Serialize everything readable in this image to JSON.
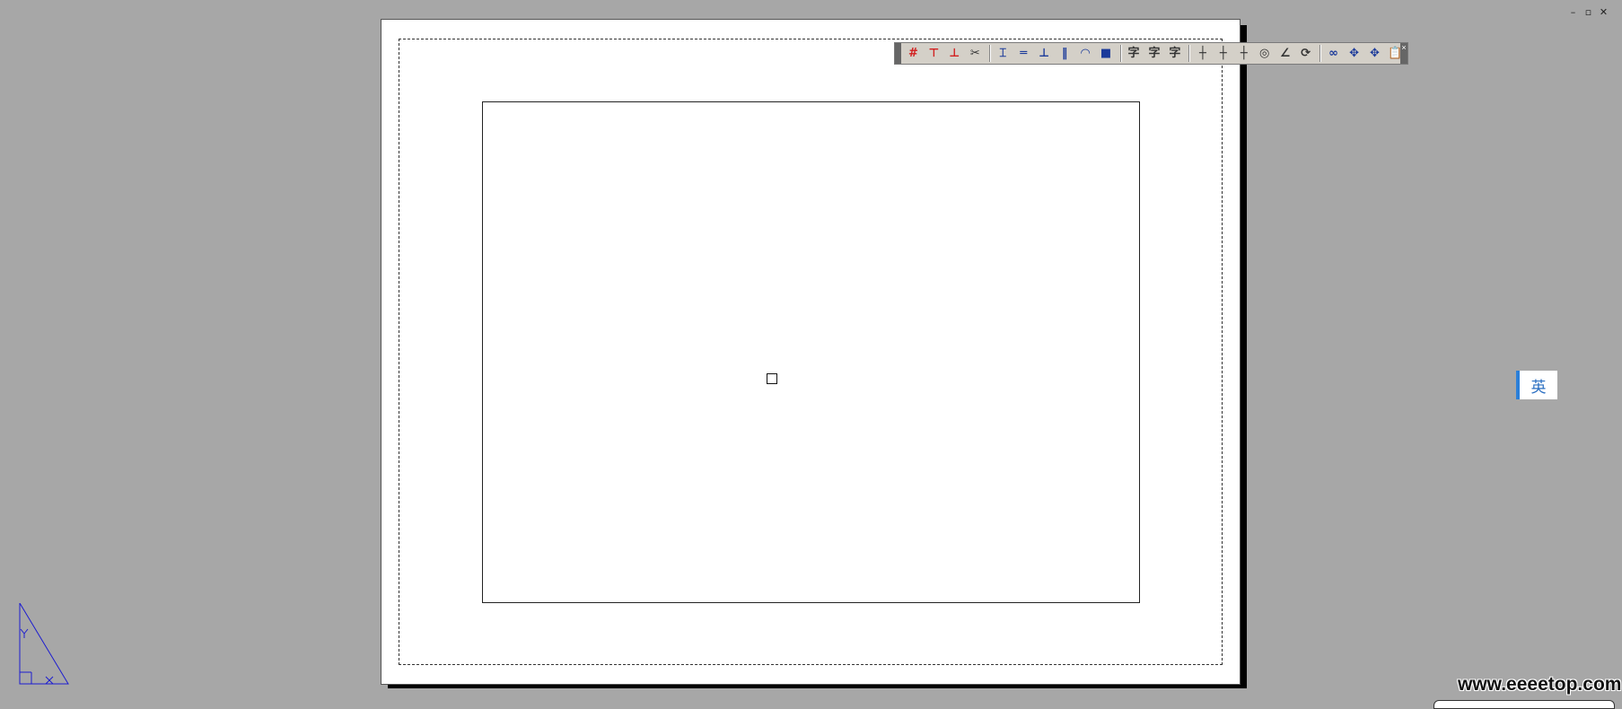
{
  "window_controls": {
    "minimize": "–",
    "restore": "▫",
    "close": "✕"
  },
  "toolbar": {
    "close": "×",
    "icons": [
      {
        "name": "dim-grid-red-icon",
        "glyph": "#",
        "color": "red"
      },
      {
        "name": "dim-pair-red-icon",
        "glyph": "⊤",
        "color": "red"
      },
      {
        "name": "dim-tee-red-icon",
        "glyph": "⊥",
        "color": "red"
      },
      {
        "name": "scissors-icon",
        "glyph": "✂",
        "color": "dark"
      },
      {
        "sep": true
      },
      {
        "name": "center-mark-icon",
        "glyph": "⌶",
        "color": "blue"
      },
      {
        "name": "double-line-icon",
        "glyph": "═",
        "color": "blue"
      },
      {
        "name": "baseline-dim-icon",
        "glyph": "⊥",
        "color": "blue"
      },
      {
        "name": "vertical-dim-icon",
        "glyph": "‖",
        "color": "blue"
      },
      {
        "name": "arc-dim-icon",
        "glyph": "◠",
        "color": "blue"
      },
      {
        "name": "block-icon",
        "glyph": "■",
        "color": "blue"
      },
      {
        "sep": true
      },
      {
        "name": "text-style-icon",
        "glyph": "字",
        "color": "dark"
      },
      {
        "name": "text-icon",
        "glyph": "字",
        "color": "dark"
      },
      {
        "name": "text-edit-icon",
        "glyph": "字",
        "color": "dark"
      },
      {
        "sep": true
      },
      {
        "name": "hatch-grid-icon",
        "glyph": "┼",
        "color": "dark"
      },
      {
        "name": "linear-dim-icon",
        "glyph": "┼",
        "color": "dark"
      },
      {
        "name": "continue-dim-icon",
        "glyph": "┼",
        "color": "dark"
      },
      {
        "name": "radius-dim-icon",
        "glyph": "◎",
        "color": "dark"
      },
      {
        "name": "angle-dim-icon",
        "glyph": "∠",
        "color": "dark"
      },
      {
        "name": "arc-length-icon",
        "glyph": "⟳",
        "color": "dark"
      },
      {
        "sep": true
      },
      {
        "name": "break-link-icon",
        "glyph": "∞",
        "color": "blue"
      },
      {
        "name": "move-icon",
        "glyph": "✥",
        "color": "blue"
      },
      {
        "name": "pan-icon",
        "glyph": "✥",
        "color": "blue"
      },
      {
        "name": "clipboard-icon",
        "glyph": "📋",
        "color": "dark"
      }
    ]
  },
  "ime_indicator": {
    "label": "英"
  },
  "watermark": {
    "text": "www.eeeetop.com"
  },
  "colors": {
    "background": "#a7a7a7",
    "ucs": "#1c1cd0",
    "ime_accent": "#2b7fd8"
  }
}
